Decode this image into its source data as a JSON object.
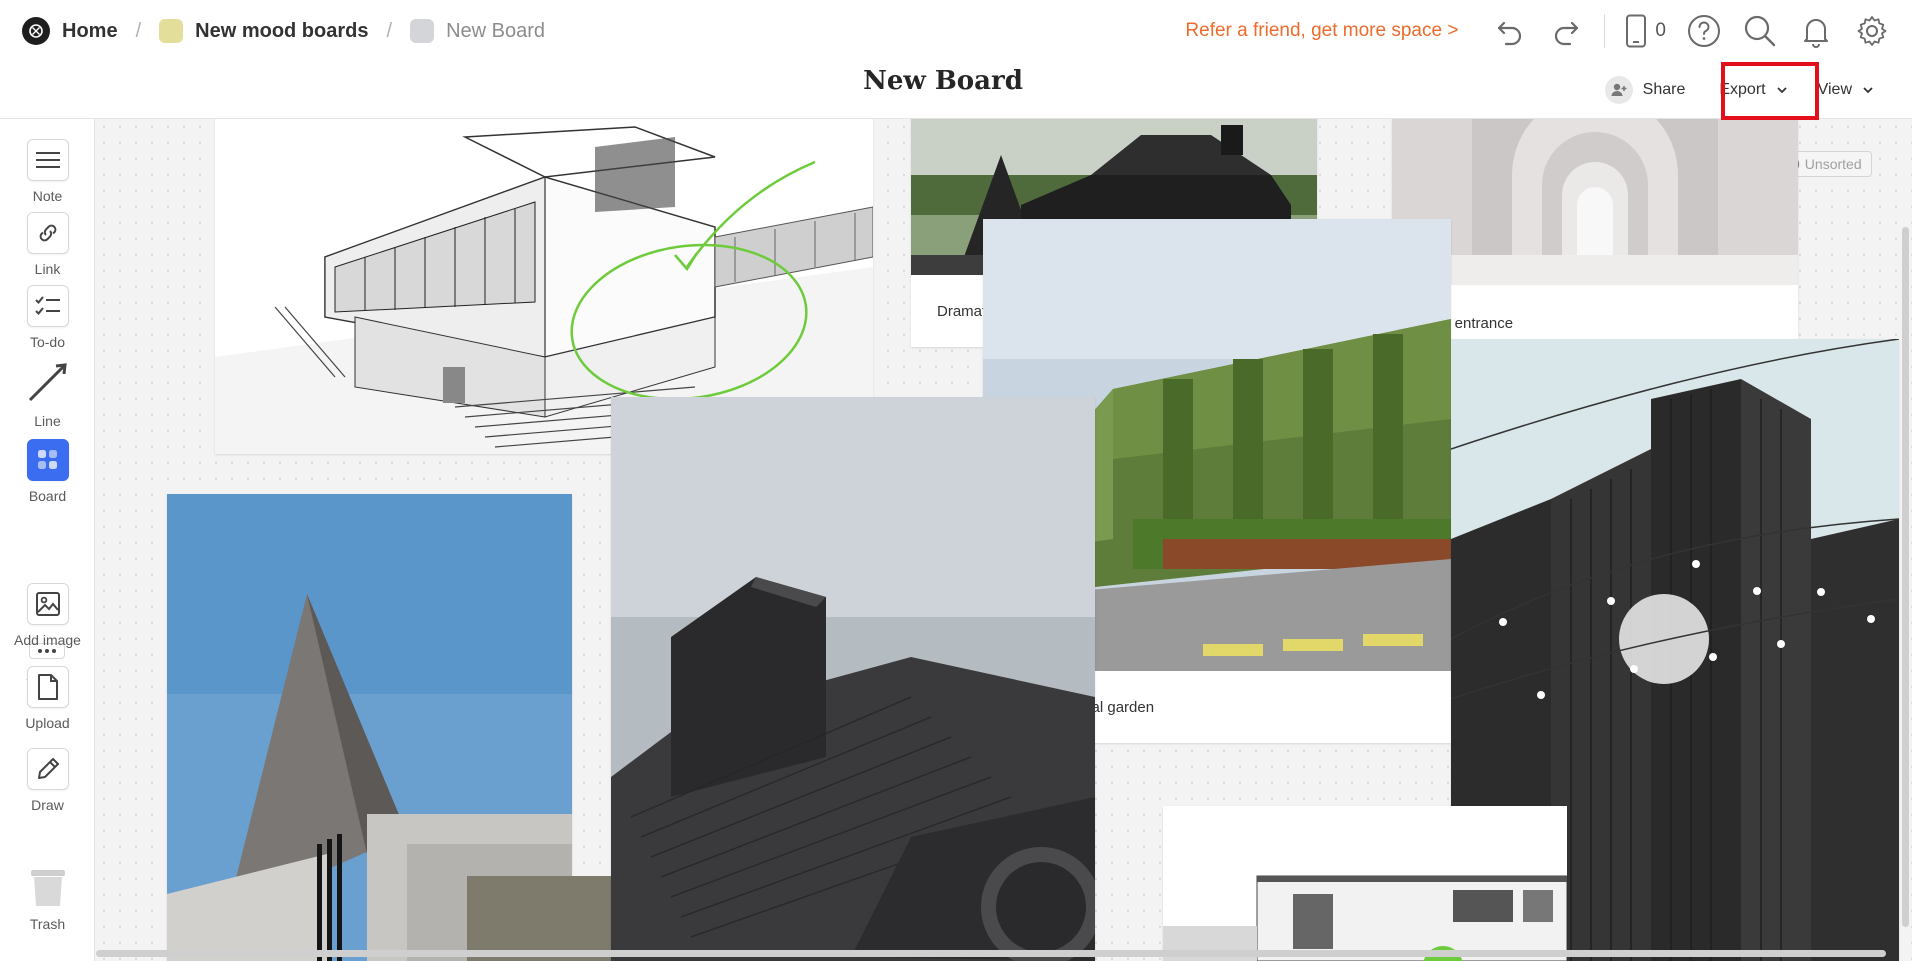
{
  "breadcrumb": {
    "home": "Home",
    "separator": "/",
    "parent": "New mood boards",
    "parent_color": "#e3df9b",
    "current": "New Board",
    "current_color": "#d4d5d8"
  },
  "header": {
    "refer_text": "Refer a friend, get more space >",
    "refer_color": "#ec6b2d",
    "device_count": "0",
    "board_title": "New Board",
    "share_label": "Share",
    "export_label": "Export",
    "view_label": "View"
  },
  "sidebar": {
    "tools": [
      {
        "label": "Note",
        "icon": "note-icon"
      },
      {
        "label": "Link",
        "icon": "link-icon"
      },
      {
        "label": "To-do",
        "icon": "todo-icon"
      },
      {
        "label": "Line",
        "icon": "line-icon"
      },
      {
        "label": "Board",
        "icon": "board-icon"
      },
      {
        "label": "Add image",
        "icon": "image-icon"
      },
      {
        "label": "Upload",
        "icon": "upload-icon"
      },
      {
        "label": "Draw",
        "icon": "pencil-icon"
      },
      {
        "label": "Trash",
        "icon": "trash-icon"
      }
    ],
    "accent": "#3a6df0"
  },
  "canvas": {
    "unsorted_count": "0",
    "unsorted_label": "Unsorted",
    "cards": [
      {
        "name": "sketch-house-card",
        "caption": ""
      },
      {
        "name": "dark-barn-card",
        "caption": "Dramatic dark tones"
      },
      {
        "name": "arch-corridor-card",
        "caption": "Main entrance"
      },
      {
        "name": "green-wall-card",
        "caption": "Exterior social garden"
      },
      {
        "name": "concrete-building-card",
        "caption": ""
      },
      {
        "name": "dark-wood-roof-card",
        "caption": ""
      },
      {
        "name": "black-towers-card",
        "caption": ""
      },
      {
        "name": "white-modern-house-card",
        "caption": ""
      },
      {
        "name": "color-swatch-card",
        "caption": ""
      }
    ]
  }
}
